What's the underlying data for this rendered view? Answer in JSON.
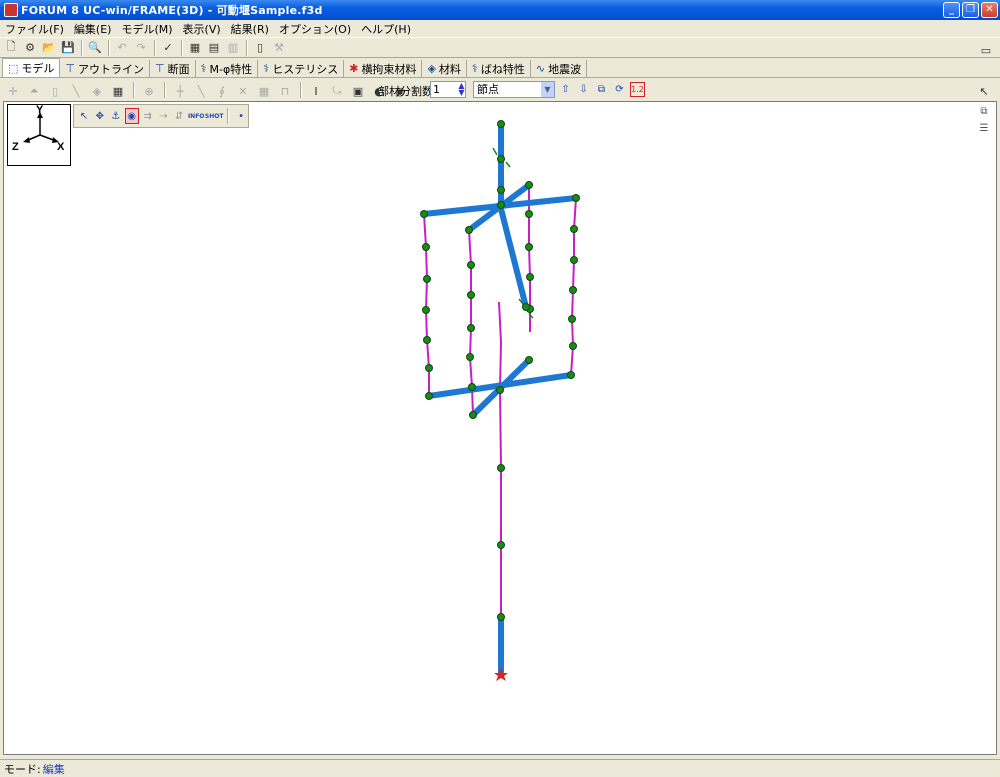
{
  "window": {
    "title": "FORUM 8  UC-win/FRAME(3D) - 可動堰Sample.f3d"
  },
  "window_buttons": {
    "minimize": "_",
    "maximize": "❐",
    "close": "✕"
  },
  "menu": [
    "ファイル(F)",
    "編集(E)",
    "モデル(M)",
    "表示(V)",
    "結果(R)",
    "オプション(O)",
    "ヘルプ(H)"
  ],
  "tabs": [
    {
      "label": "モデル",
      "icon": "model-icon"
    },
    {
      "label": "アウトライン",
      "icon": "outline-icon"
    },
    {
      "label": "断面",
      "icon": "section-icon"
    },
    {
      "label": "M-φ特性",
      "icon": "m-phi-icon"
    },
    {
      "label": "ヒステリシス",
      "icon": "hysteresis-icon"
    },
    {
      "label": "横拘束材料",
      "icon": "lateral-confinement-icon"
    },
    {
      "label": "材料",
      "icon": "material-icon"
    },
    {
      "label": "ばね特性",
      "icon": "spring-icon"
    },
    {
      "label": "地震波",
      "icon": "seismic-wave-icon"
    }
  ],
  "toolbar2": {
    "division_label": "部材分割数",
    "division_value": "1",
    "node_combo": "節点",
    "scale_label": "1.2"
  },
  "floating_toolbar": {
    "info_label": "INFO",
    "shot_label": "SHOT"
  },
  "axis": {
    "y": "Y",
    "z": "Z",
    "x": "X"
  },
  "status": {
    "mode_label": "モード:",
    "mode_value": "編集"
  },
  "colors": {
    "beam": "#1e78d2",
    "spring": "#c81ec8",
    "node": "#1a8a1a",
    "support": "#e02020"
  }
}
